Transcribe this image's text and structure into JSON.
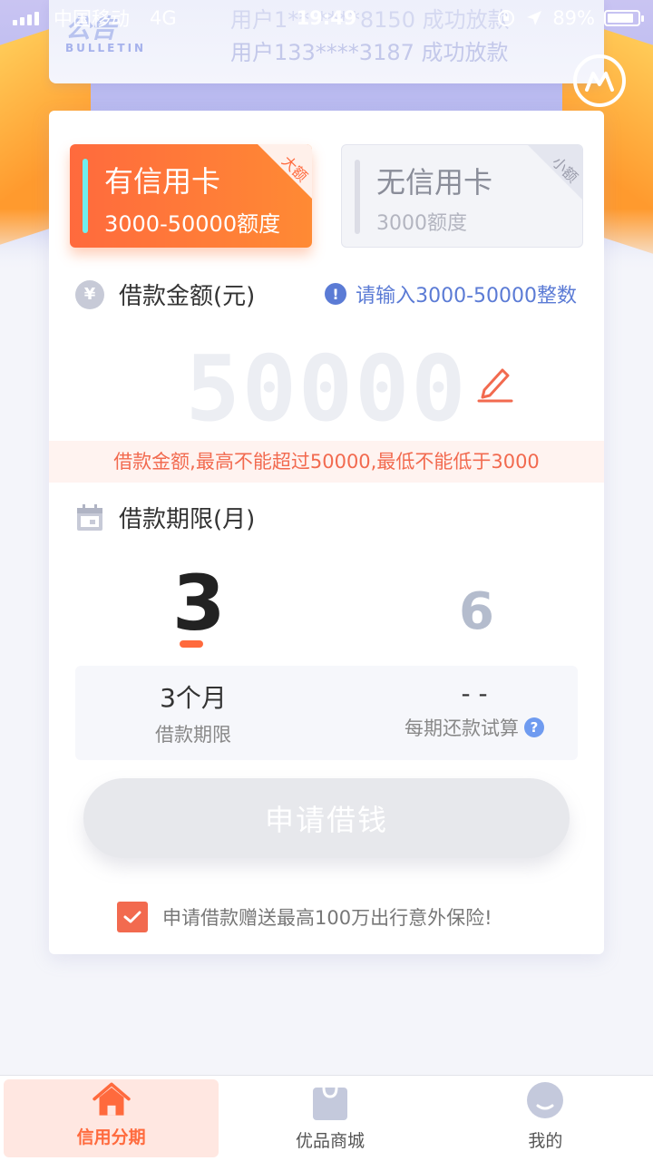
{
  "status_bar": {
    "carrier": "中国移动",
    "network": "4G",
    "time": "19:49",
    "battery": "89%"
  },
  "bulletin": {
    "logo_text": "公告",
    "logo_sub": "BULLETIN",
    "line1": "用户1** ****8150 成功放款",
    "line2": "用户133****3187 成功放款"
  },
  "card_types": [
    {
      "title": "有信用卡",
      "subtitle": "3000-50000额度",
      "corner": "大额"
    },
    {
      "title": "无信用卡",
      "subtitle": "3000额度",
      "corner": "小额"
    }
  ],
  "amount_section": {
    "label": "借款金额(元)",
    "icon": "¥",
    "hint": "请输入3000-50000整数",
    "amount": "50000",
    "limit_note": "借款金额,最高不能超过50000,最低不能低于3000"
  },
  "term_section": {
    "label": "借款期限(月)",
    "options": [
      "3",
      "6"
    ],
    "selected": "3"
  },
  "summary": {
    "term_value": "3个月",
    "term_label": "借款期限",
    "repay_value": "- -",
    "repay_label": "每期还款试算",
    "repay_help": "?"
  },
  "apply_button": "申请借钱",
  "agreement": "申请借款赠送最高100万出行意外保险!",
  "tabs": [
    {
      "label": "信用分期",
      "active": true
    },
    {
      "label": "优品商城",
      "active": false
    },
    {
      "label": "我的",
      "active": false
    }
  ],
  "colors": {
    "accent": "#ff6a3d",
    "hint_blue": "#5b7bd5",
    "warning_red": "#f26a4f"
  }
}
